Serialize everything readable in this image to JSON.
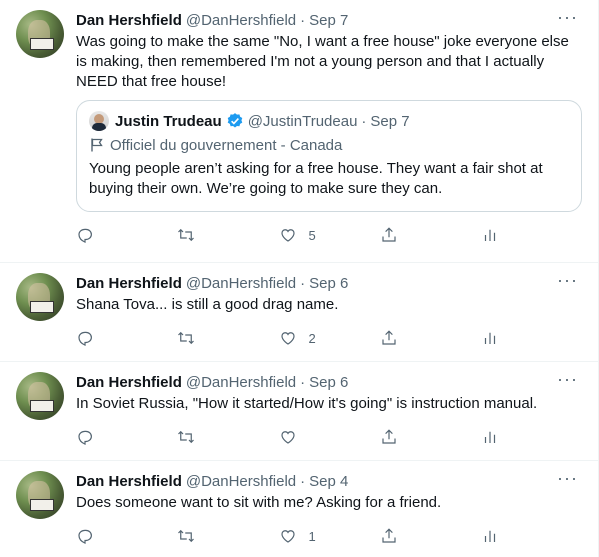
{
  "tweets": [
    {
      "name": "Dan Hershfield",
      "handle": "@DanHershfield",
      "sep": "·",
      "date": "Sep 7",
      "text": "Was going to make the same \"No, I want a free house\" joke everyone else is making, then remembered I'm not a young person and that I actually NEED that free house!",
      "more": "···",
      "quote": {
        "name": "Justin Trudeau",
        "handle": "@JustinTrudeau",
        "sep": "·",
        "date": "Sep 7",
        "label": "Officiel du gouvernement - Canada",
        "text": "Young people aren’t asking for a free house. They want a fair shot at buying their own. We’re going to make sure they can."
      },
      "actions": {
        "reply": "",
        "retweet": "",
        "like": "5"
      }
    },
    {
      "name": "Dan Hershfield",
      "handle": "@DanHershfield",
      "sep": "·",
      "date": "Sep 6",
      "text": "Shana Tova... is still a good drag name.",
      "more": "···",
      "actions": {
        "reply": "",
        "retweet": "",
        "like": "2"
      }
    },
    {
      "name": "Dan Hershfield",
      "handle": "@DanHershfield",
      "sep": "·",
      "date": "Sep 6",
      "text": "In Soviet Russia, \"How it started/How it's going\" is instruction manual.",
      "more": "···",
      "actions": {
        "reply": "",
        "retweet": "",
        "like": ""
      }
    },
    {
      "name": "Dan Hershfield",
      "handle": "@DanHershfield",
      "sep": "·",
      "date": "Sep 4",
      "text": "Does someone want to sit with me? Asking for a friend.",
      "more": "···",
      "actions": {
        "reply": "",
        "retweet": "",
        "like": "1"
      }
    }
  ],
  "colors": {
    "text": "#0f1419",
    "muted": "#536471",
    "border": "#eff3f4",
    "verified": "#1d9bf0"
  },
  "icons": [
    "reply-icon",
    "retweet-icon",
    "like-icon",
    "share-icon",
    "analytics-icon",
    "more-icon",
    "verified-icon",
    "flag-icon"
  ]
}
